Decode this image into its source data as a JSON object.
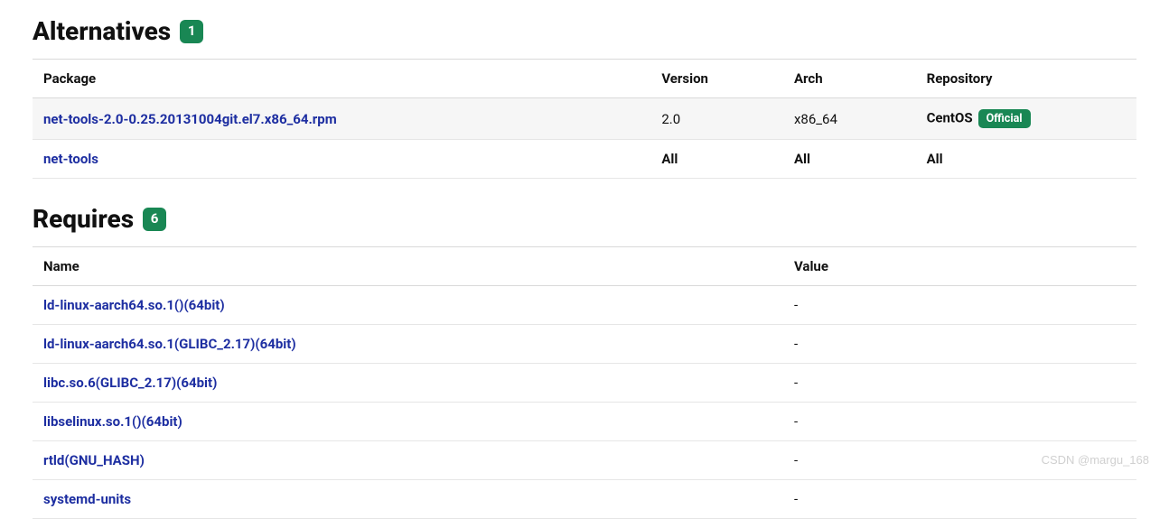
{
  "alternatives": {
    "title": "Alternatives",
    "count": "1",
    "headers": {
      "package": "Package",
      "version": "Version",
      "arch": "Arch",
      "repository": "Repository"
    },
    "rows": [
      {
        "package": "net-tools-2.0-0.25.20131004git.el7.x86_64.rpm",
        "version": "2.0",
        "arch": "x86_64",
        "repo": "CentOS",
        "repo_badge": "Official",
        "striped": true
      },
      {
        "package": "net-tools",
        "version": "All",
        "arch": "All",
        "repo": "All",
        "repo_badge": "",
        "striped": false,
        "bold_cells": true
      }
    ]
  },
  "requires": {
    "title": "Requires",
    "count": "6",
    "headers": {
      "name": "Name",
      "value": "Value"
    },
    "rows": [
      {
        "name": "ld-linux-aarch64.so.1()(64bit)",
        "value": "-"
      },
      {
        "name": "ld-linux-aarch64.so.1(GLIBC_2.17)(64bit)",
        "value": "-"
      },
      {
        "name": "libc.so.6(GLIBC_2.17)(64bit)",
        "value": "-"
      },
      {
        "name": "libselinux.so.1()(64bit)",
        "value": "-"
      },
      {
        "name": "rtld(GNU_HASH)",
        "value": "-"
      },
      {
        "name": "systemd-units",
        "value": "-"
      }
    ]
  },
  "watermark": "CSDN @margu_168"
}
